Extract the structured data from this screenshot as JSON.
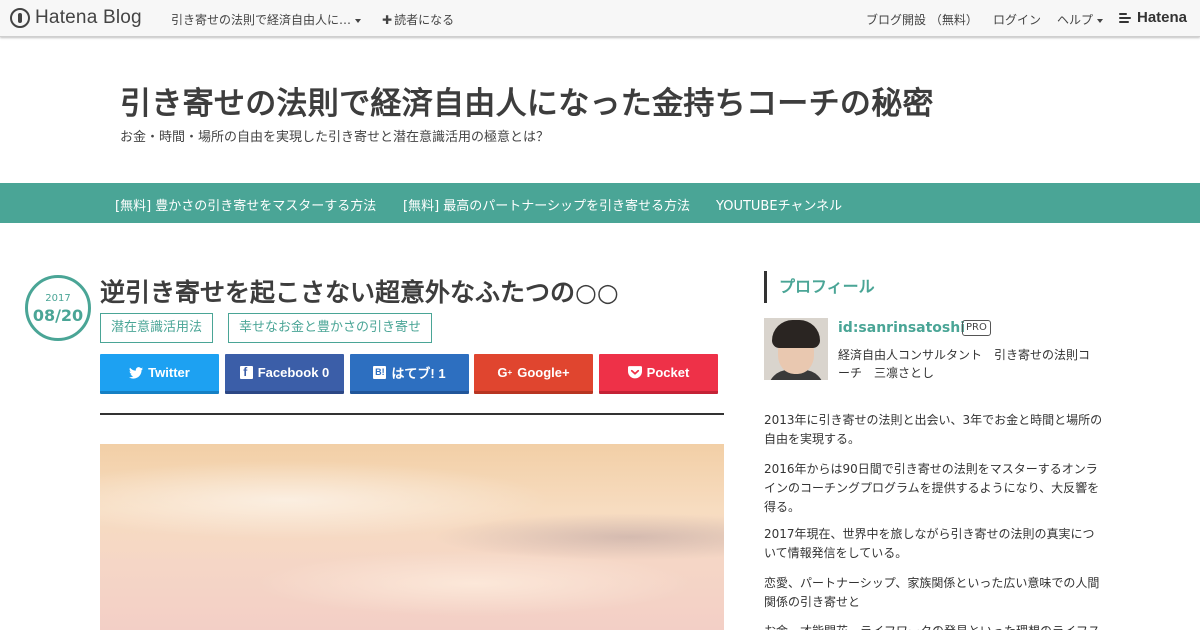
{
  "topbar": {
    "logo_text": "Hatena Blog",
    "blog_name": "引き寄せの法則で経済自由人に…",
    "subscribe_label": "読者になる",
    "open_blog_label": "ブログ開設 （無料）",
    "login_label": "ログイン",
    "help_label": "ヘルプ",
    "brand_label": "Hatena"
  },
  "header": {
    "title": "引き寄せの法則で経済自由人になった金持ちコーチの秘密",
    "description": "お金・時間・場所の自由を実現した引き寄せと潜在意識活用の極意とは？"
  },
  "nav": {
    "items": [
      {
        "label": "[無料] 豊かさの引き寄せをマスターする方法"
      },
      {
        "label": "[無料] 最高のパートナーシップを引き寄せる方法"
      },
      {
        "label": "YOUTUBEチャンネル"
      }
    ]
  },
  "entry": {
    "date_year": "2017",
    "date_md": "08/20",
    "title": "逆引き寄せを起こさない超意外なふたつの○○",
    "tags": [
      "潜在意識活用法",
      "幸せなお金と豊かさの引き寄せ"
    ],
    "share": {
      "twitter": "Twitter",
      "facebook": "Facebook 0",
      "hatena": "はてブ! 1",
      "google": "Google+",
      "pocket": "Pocket"
    }
  },
  "sidebar": {
    "heading": "プロフィール",
    "profile_id": "id:sanrinsatoshi",
    "pro_badge": "PRO",
    "profile_desc": "経済自由人コンサルタント　引き寄せの法則コーチ　三凛さとし",
    "paragraphs": [
      "2013年に引き寄せの法則と出会い、3年でお金と時間と場所の自由を実現する。",
      "2016年からは90日間で引き寄せの法則をマスターするオンラインのコーチングプログラムを提供するようになり、大反響を得る。",
      "2017年現在、世界中を旅しながら引き寄せの法則の真実について情報発信をしている。",
      "恋愛、パートナーシップ、家族関係といった広い意味での人間関係の引き寄せと",
      "お金、才能開花、ライフワークの発見といった理想のライフス"
    ]
  },
  "colors": {
    "accent": "#4aa596",
    "twitter": "#1da1f2",
    "facebook": "#3b5ea8",
    "hatena": "#2d6fc0",
    "google": "#e0452f",
    "pocket": "#ee3148"
  },
  "icons": {
    "hatena_blog_logo": "hatena-blog-logo-icon",
    "caret": "caret-down-icon",
    "plus": "plus-icon",
    "twitter": "twitter-bird-icon",
    "facebook": "facebook-icon",
    "hatena_bookmark": "hatena-bookmark-icon",
    "google_plus": "google-plus-icon",
    "pocket": "pocket-icon"
  }
}
